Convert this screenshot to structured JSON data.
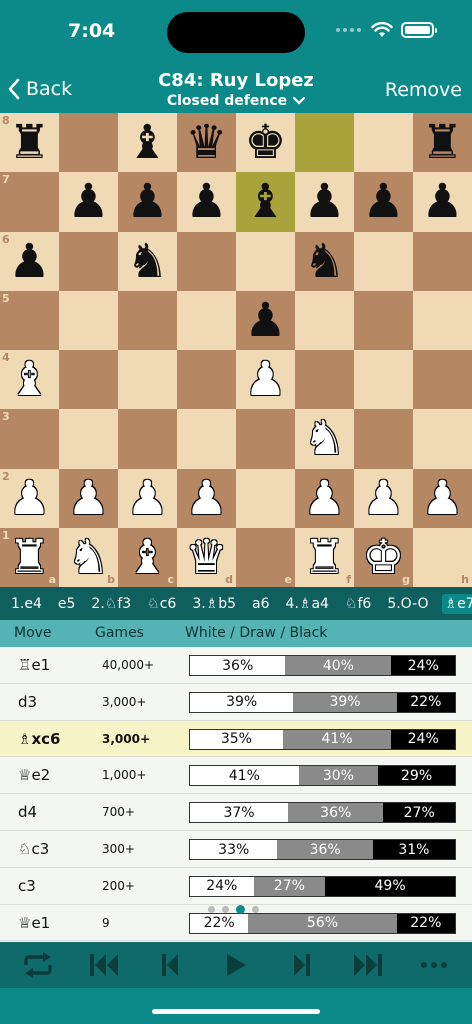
{
  "status": {
    "time": "7:04"
  },
  "nav": {
    "back_label": "Back",
    "title": "C84: Ruy Lopez",
    "subtitle": "Closed defence",
    "remove_label": "Remove"
  },
  "board": {
    "rank_labels": [
      "8",
      "7",
      "6",
      "5",
      "4",
      "3",
      "2",
      "1"
    ],
    "file_labels": [
      "a",
      "b",
      "c",
      "d",
      "e",
      "f",
      "g",
      "h"
    ],
    "highlight_squares": [
      "f8",
      "e7"
    ],
    "pieces": [
      {
        "sq": "a8",
        "p": "♜",
        "c": "b"
      },
      {
        "sq": "c8",
        "p": "♝",
        "c": "b"
      },
      {
        "sq": "d8",
        "p": "♛",
        "c": "b"
      },
      {
        "sq": "e8",
        "p": "♚",
        "c": "b"
      },
      {
        "sq": "h8",
        "p": "♜",
        "c": "b"
      },
      {
        "sq": "b7",
        "p": "♟",
        "c": "b"
      },
      {
        "sq": "c7",
        "p": "♟",
        "c": "b"
      },
      {
        "sq": "d7",
        "p": "♟",
        "c": "b"
      },
      {
        "sq": "e7",
        "p": "♝",
        "c": "b"
      },
      {
        "sq": "f7",
        "p": "♟",
        "c": "b"
      },
      {
        "sq": "g7",
        "p": "♟",
        "c": "b"
      },
      {
        "sq": "h7",
        "p": "♟",
        "c": "b"
      },
      {
        "sq": "a6",
        "p": "♟",
        "c": "b"
      },
      {
        "sq": "c6",
        "p": "♞",
        "c": "b"
      },
      {
        "sq": "f6",
        "p": "♞",
        "c": "b"
      },
      {
        "sq": "e5",
        "p": "♟",
        "c": "b"
      },
      {
        "sq": "a4",
        "p": "♝",
        "c": "w"
      },
      {
        "sq": "e4",
        "p": "♟",
        "c": "w"
      },
      {
        "sq": "f3",
        "p": "♞",
        "c": "w"
      },
      {
        "sq": "a2",
        "p": "♟",
        "c": "w"
      },
      {
        "sq": "b2",
        "p": "♟",
        "c": "w"
      },
      {
        "sq": "c2",
        "p": "♟",
        "c": "w"
      },
      {
        "sq": "d2",
        "p": "♟",
        "c": "w"
      },
      {
        "sq": "f2",
        "p": "♟",
        "c": "w"
      },
      {
        "sq": "g2",
        "p": "♟",
        "c": "w"
      },
      {
        "sq": "h2",
        "p": "♟",
        "c": "w"
      },
      {
        "sq": "a1",
        "p": "♜",
        "c": "w"
      },
      {
        "sq": "b1",
        "p": "♞",
        "c": "w"
      },
      {
        "sq": "c1",
        "p": "♝",
        "c": "w"
      },
      {
        "sq": "d1",
        "p": "♛",
        "c": "w"
      },
      {
        "sq": "f1",
        "p": "♜",
        "c": "w"
      },
      {
        "sq": "g1",
        "p": "♚",
        "c": "w"
      }
    ]
  },
  "move_line": [
    "1.e4",
    "e5",
    "2.♘f3",
    "♘c6",
    "3.♗b5",
    "a6",
    "4.♗a4",
    "♘f6",
    "5.O-O",
    "♗e7"
  ],
  "active_move_index": 9,
  "table": {
    "headers": {
      "move": "Move",
      "games": "Games",
      "wdb": "White / Draw / Black"
    },
    "rows": [
      {
        "move": "♖e1",
        "games": "40,000+",
        "white": 36,
        "draw": 40,
        "black": 24,
        "w_label": "36%",
        "d_label": "40%",
        "b_label": "24%"
      },
      {
        "move": "d3",
        "games": "3,000+",
        "white": 39,
        "draw": 39,
        "black": 22,
        "w_label": "39%",
        "d_label": "39%",
        "b_label": "22%"
      },
      {
        "move": "♗xc6",
        "games": "3,000+",
        "white": 35,
        "draw": 41,
        "black": 24,
        "w_label": "35%",
        "d_label": "41%",
        "b_label": "24%",
        "selected": true
      },
      {
        "move": "♕e2",
        "games": "1,000+",
        "white": 41,
        "draw": 30,
        "black": 29,
        "w_label": "41%",
        "d_label": "30%",
        "b_label": "29%"
      },
      {
        "move": "d4",
        "games": "700+",
        "white": 37,
        "draw": 36,
        "black": 27,
        "w_label": "37%",
        "d_label": "36%",
        "b_label": "27%"
      },
      {
        "move": "♘c3",
        "games": "300+",
        "white": 33,
        "draw": 36,
        "black": 31,
        "w_label": "33%",
        "d_label": "36%",
        "b_label": "31%"
      },
      {
        "move": "c3",
        "games": "200+",
        "white": 24,
        "draw": 27,
        "black": 49,
        "w_label": "24%",
        "d_label": "27%",
        "b_label": "49%"
      },
      {
        "move": "♕e1",
        "games": "9",
        "white": 22,
        "draw": 56,
        "black": 22,
        "w_label": "22%",
        "d_label": "56%",
        "b_label": "22%"
      }
    ]
  },
  "pager": {
    "count": 4,
    "active": 2
  },
  "toolbar": {
    "buttons": [
      "flip-board-icon",
      "first-move-icon",
      "previous-move-icon",
      "play-icon",
      "next-move-icon",
      "last-move-icon",
      "more-icon"
    ]
  },
  "colors": {
    "teal": "#0c8a8a",
    "light_square": "#f0d9b5",
    "dark_square": "#b58863",
    "highlight": "#aaa23a"
  }
}
